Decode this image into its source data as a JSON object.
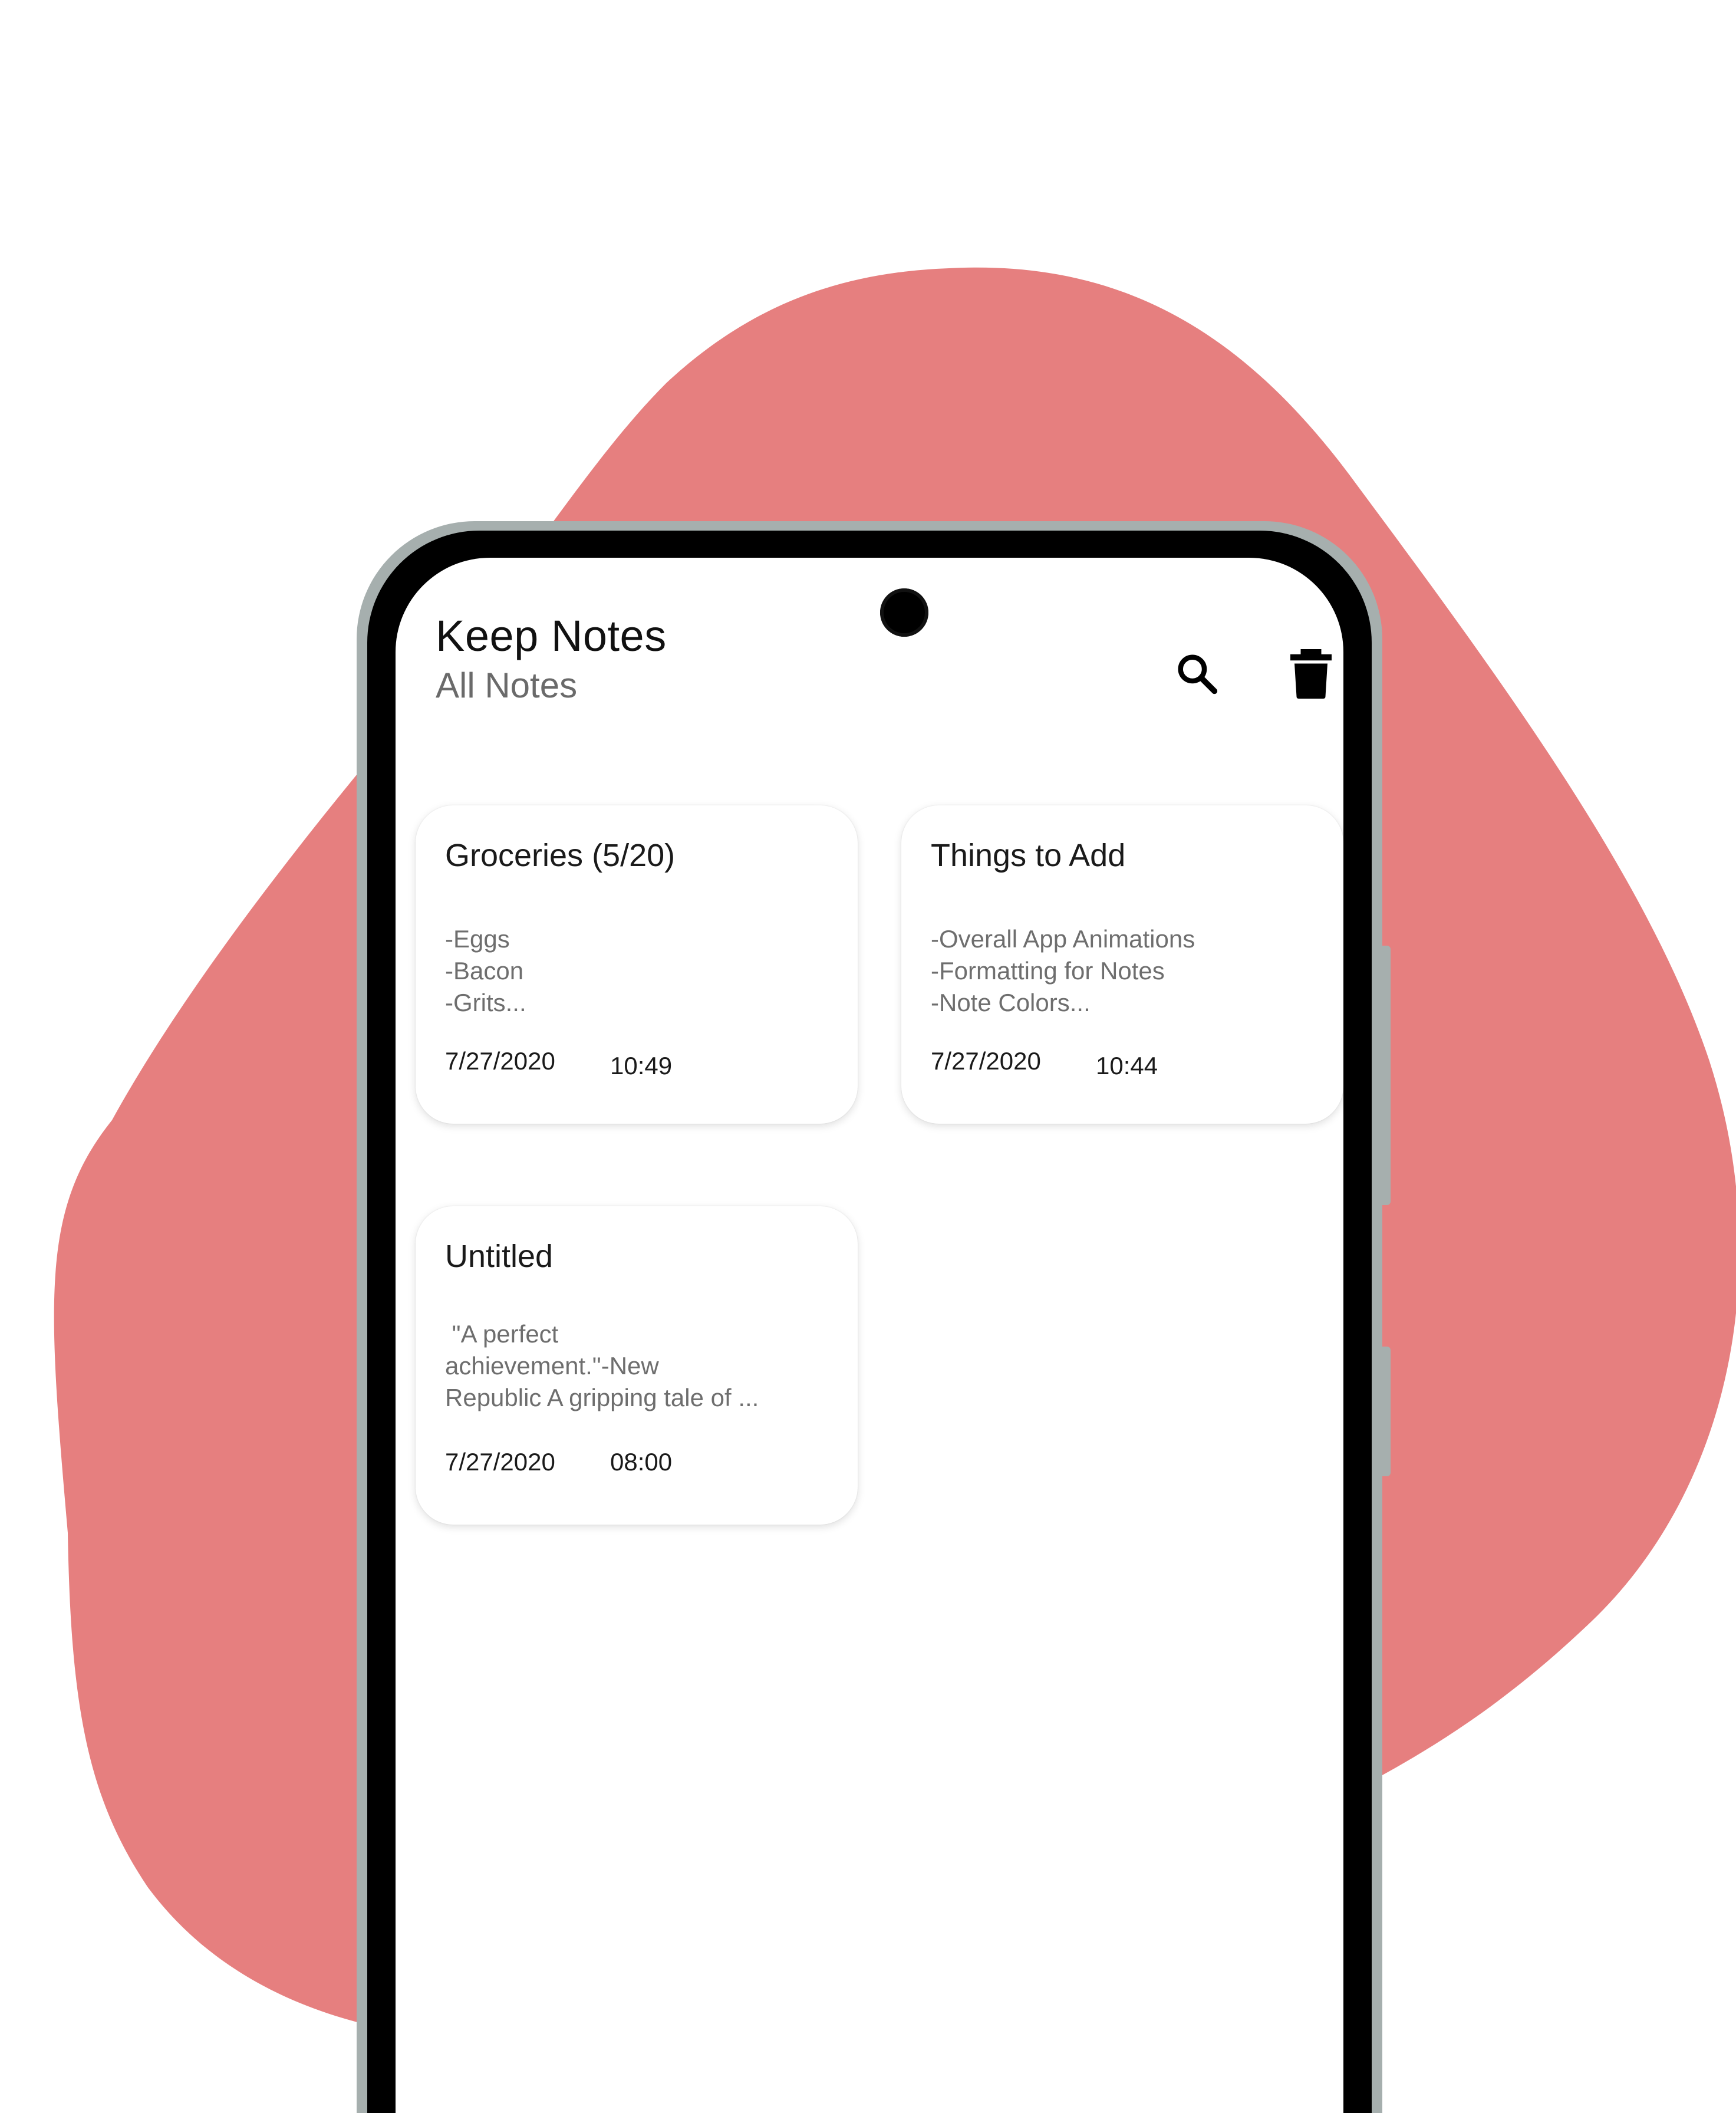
{
  "colors": {
    "blob": "#e67f7f",
    "phone_frame": "#a6afae",
    "bezel": "#000000",
    "screen": "#ffffff",
    "title_text": "#111111",
    "subtitle_text": "#6a6a6a",
    "preview_text": "#6e6e6e"
  },
  "header": {
    "title": "Keep Notes",
    "subtitle": "All Notes",
    "search_icon": "search-icon",
    "delete_icon": "trash-icon"
  },
  "notes": [
    {
      "title": "Groceries (5/20)",
      "lines": [
        "-Eggs",
        "-Bacon",
        "-Grits..."
      ],
      "date": "7/27/2020",
      "time": "10:49"
    },
    {
      "title": "Things to Add",
      "lines": [
        "-Overall App Animations",
        "-Formatting for Notes",
        "-Note Colors..."
      ],
      "date": "7/27/2020",
      "time": "10:44"
    },
    {
      "title": "Untitled",
      "lines": [
        " \"A perfect",
        "achievement.\"-New",
        "Republic A gripping tale of ..."
      ],
      "date": "7/27/2020",
      "time": "08:00"
    }
  ]
}
